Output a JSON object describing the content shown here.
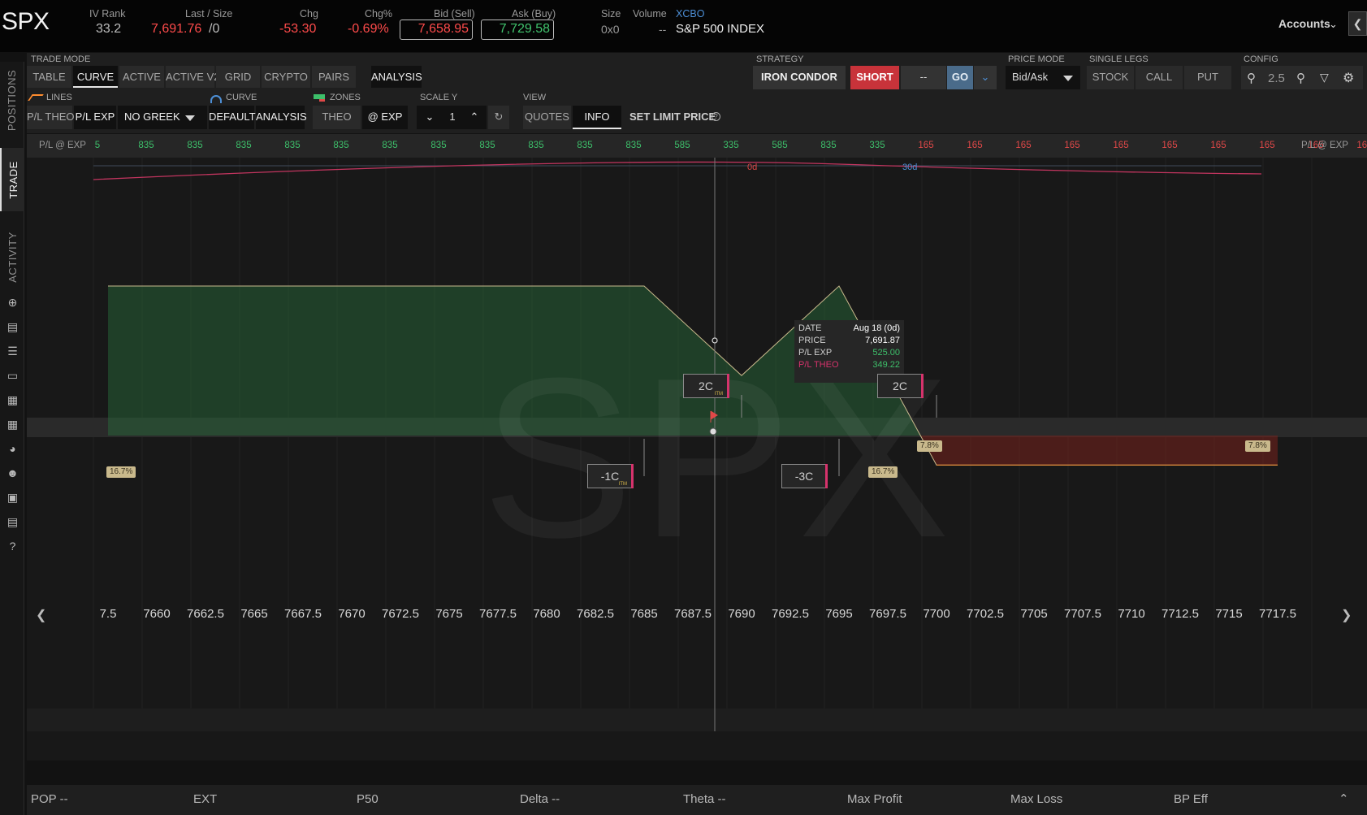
{
  "quote": {
    "symbol": "SPX",
    "iv_rank_label": "IV Rank",
    "iv_rank": "33.2",
    "last_label": "Last / Size",
    "last": "7,691.76",
    "size": "/0",
    "chg_label": "Chg",
    "chg": "-53.30",
    "chgpct_label": "Chg%",
    "chgpct": "-0.69%",
    "bid_label": "Bid (Sell)",
    "bid": "7,658.95",
    "ask_label": "Ask (Buy)",
    "ask": "7,729.58",
    "sizefield_label": "Size",
    "sizefield": "0x0",
    "volume_label": "Volume",
    "volume": "--",
    "exchange": "XCBO",
    "description": "S&P 500 INDEX",
    "accounts": "Accounts"
  },
  "sidebar": {
    "tabs": [
      "POSITIONS",
      "TRADE",
      "ACTIVITY"
    ],
    "icons": [
      "crosshair-icon",
      "news-icon",
      "list-icon",
      "tv-icon",
      "calendar-grid-icon",
      "grid-icon",
      "gauge-icon",
      "community-icon",
      "calendar-icon",
      "chart-icon",
      "help-icon"
    ]
  },
  "toolbar": {
    "trade_mode_label": "TRADE MODE",
    "modes": [
      "TABLE",
      "CURVE",
      "ACTIVE",
      "ACTIVE V2",
      "GRID",
      "CRYPTO",
      "PAIRS",
      "ANALYSIS"
    ],
    "lines_label": "LINES",
    "lines": [
      "P/L THEO",
      "P/L EXP"
    ],
    "greek": "NO GREEK",
    "curve_label": "CURVE",
    "curve": [
      "DEFAULT",
      "ANALYSIS"
    ],
    "zones_label": "ZONES",
    "zones": [
      "THEO",
      "@ EXP"
    ],
    "scale_label": "SCALE Y",
    "scale_value": "1",
    "view_label": "VIEW",
    "view": [
      "QUOTES",
      "INFO"
    ],
    "set_limit": "SET LIMIT PRICE",
    "strategy_label": "STRATEGY",
    "strategy": "IRON CONDOR",
    "side": "SHORT",
    "qty": "--",
    "go": "GO",
    "price_mode_label": "PRICE MODE",
    "price_mode": "Bid/Ask",
    "single_legs_label": "SINGLE LEGS",
    "single_legs": [
      "STOCK",
      "CALL",
      "PUT"
    ],
    "config_label": "CONFIG",
    "zoom": "2.5"
  },
  "pl_strip": {
    "label": "P/L @ EXP",
    "values": [
      "5",
      "835",
      "835",
      "835",
      "835",
      "835",
      "835",
      "835",
      "835",
      "835",
      "835",
      "835",
      "585",
      "335",
      "585",
      "835",
      "335",
      "165",
      "165",
      "165",
      "165",
      "165",
      "165",
      "165",
      "165",
      "165",
      "165"
    ],
    "colors": {
      "profit": "#3dbf6a",
      "loss": "#e04848"
    }
  },
  "tooltip": {
    "date_label": "DATE",
    "date": "Aug 18 (0d)",
    "price_label": "PRICE",
    "price": "7,691.87",
    "plexp_label": "P/L EXP",
    "plexp": "525.00",
    "pltheo_label": "P/L THEO",
    "pltheo": "349.22",
    "extra": "--"
  },
  "chart_data": {
    "type": "line",
    "x_ticks": [
      "7.5",
      "7660",
      "7662.5",
      "7665",
      "7667.5",
      "7670",
      "7672.5",
      "7675",
      "7677.5",
      "7680",
      "7682.5",
      "7685",
      "7687.5",
      "7690",
      "7692.5",
      "7695",
      "7697.5",
      "7700",
      "7702.5",
      "7705",
      "7707.5",
      "7710",
      "7712.5",
      "7715",
      "7717.5"
    ],
    "day_labels": [
      "0d",
      "30d"
    ],
    "pl_at_exp": {
      "x": [
        7657.5,
        7685,
        7690,
        7695,
        7700,
        7717.5
      ],
      "y": [
        835,
        835,
        335,
        835,
        -165,
        -165
      ]
    },
    "legs": [
      {
        "label": "2C",
        "strike": 7690,
        "itm": "ITM"
      },
      {
        "label": "-1C",
        "strike": 7685,
        "itm": "ITM"
      },
      {
        "label": "-3C",
        "strike": 7695,
        "itm": ""
      },
      {
        "label": "2C",
        "strike": 7700,
        "itm": ""
      }
    ],
    "pop_labels": [
      "16.7%",
      "16.7%",
      "7.8%",
      "7.8%"
    ],
    "watermark": "SPX"
  },
  "footer": {
    "items": [
      "POP --",
      "EXT",
      "P50",
      "Delta --",
      "Theta --",
      "Max Profit",
      "Max Loss",
      "BP Eff"
    ]
  }
}
